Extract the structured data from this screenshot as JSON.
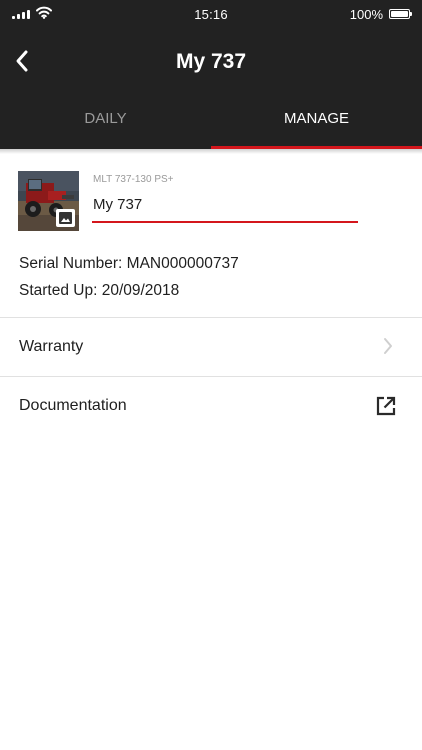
{
  "status_bar": {
    "time": "15:16",
    "battery_percent": "100%",
    "battery_level": 1.0,
    "icons": [
      "cellular-signal-icon",
      "wifi-icon",
      "battery-icon"
    ]
  },
  "nav": {
    "title": "My 737",
    "back_icon": "chevron-left-icon"
  },
  "tabs": [
    {
      "label": "DAILY",
      "active": false
    },
    {
      "label": "MANAGE",
      "active": true
    }
  ],
  "machine": {
    "thumbnail_icon": "image-icon",
    "model": "MLT 737-130 PS+",
    "name": "My 737",
    "serial_text": "Serial Number: MAN000000737",
    "started_text": "Started Up: 20/09/2018"
  },
  "menu": [
    {
      "label": "Warranty",
      "icon": "chevron-right-icon"
    },
    {
      "label": "Documentation",
      "icon": "external-link-icon"
    }
  ],
  "colors": {
    "header_bg": "#222222",
    "accent": "#d4161c",
    "inactive_tab": "#9a9a9a",
    "divider": "#e1e1e1"
  }
}
